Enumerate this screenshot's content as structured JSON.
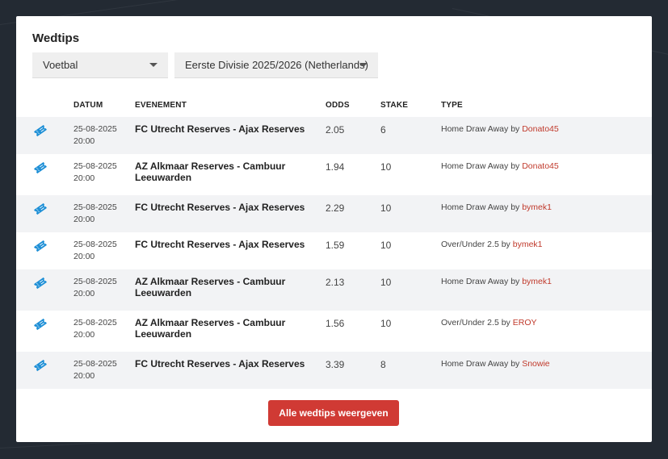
{
  "title": "Wedtips",
  "filters": {
    "sport": "Voetbal",
    "league": "Eerste Divisie 2025/2026 (Netherlands)"
  },
  "columns": {
    "datum": "DATUM",
    "evenement": "EVENEMENT",
    "odds": "ODDS",
    "stake": "STAKE",
    "type": "TYPE"
  },
  "rows": [
    {
      "date": "25-08-2025",
      "time": "20:00",
      "event": "FC Utrecht Reserves - Ajax Reserves",
      "odds": "2.05",
      "stake": "6",
      "type": "Home Draw Away",
      "by": "by",
      "user": "Donato45"
    },
    {
      "date": "25-08-2025",
      "time": "20:00",
      "event": "AZ Alkmaar Reserves - Cambuur Leeuwarden",
      "odds": "1.94",
      "stake": "10",
      "type": "Home Draw Away",
      "by": "by",
      "user": "Donato45"
    },
    {
      "date": "25-08-2025",
      "time": "20:00",
      "event": "FC Utrecht Reserves - Ajax Reserves",
      "odds": "2.29",
      "stake": "10",
      "type": "Home Draw Away",
      "by": "by",
      "user": "bymek1"
    },
    {
      "date": "25-08-2025",
      "time": "20:00",
      "event": "FC Utrecht Reserves - Ajax Reserves",
      "odds": "1.59",
      "stake": "10",
      "type": "Over/Under 2.5",
      "by": "by",
      "user": "bymek1"
    },
    {
      "date": "25-08-2025",
      "time": "20:00",
      "event": "AZ Alkmaar Reserves - Cambuur Leeuwarden",
      "odds": "2.13",
      "stake": "10",
      "type": "Home Draw Away",
      "by": "by",
      "user": "bymek1"
    },
    {
      "date": "25-08-2025",
      "time": "20:00",
      "event": "AZ Alkmaar Reserves - Cambuur Leeuwarden",
      "odds": "1.56",
      "stake": "10",
      "type": "Over/Under 2.5",
      "by": "by",
      "user": "EROY"
    },
    {
      "date": "25-08-2025",
      "time": "20:00",
      "event": "FC Utrecht Reserves - Ajax Reserves",
      "odds": "3.39",
      "stake": "8",
      "type": "Home Draw Away",
      "by": "by",
      "user": "Snowie"
    }
  ],
  "button_label": "Alle wedtips weergeven",
  "colors": {
    "accent": "#d03a34",
    "icon": "#1e8fd6",
    "user_link": "#c0392b"
  },
  "icons": {
    "row_icon": "ticket-icon",
    "select_caret": "caret-down-icon"
  }
}
